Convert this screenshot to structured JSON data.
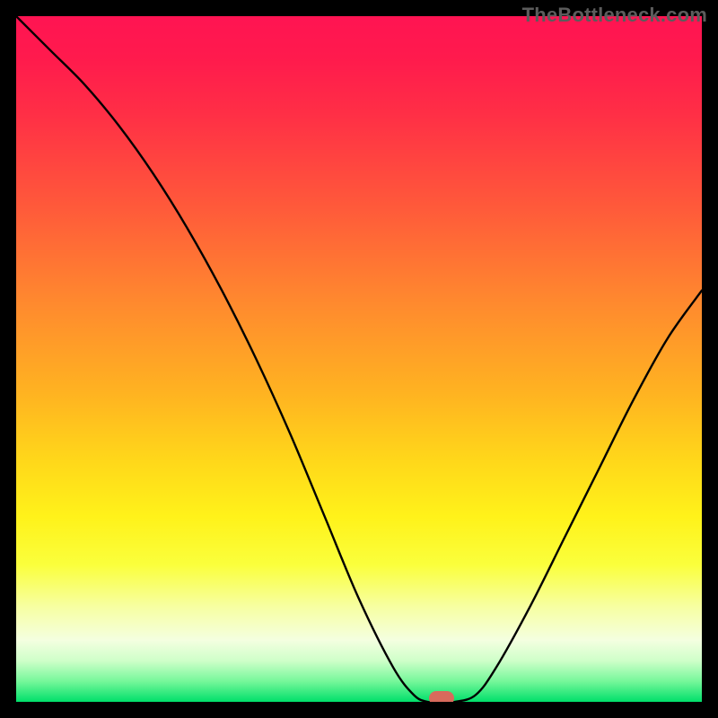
{
  "watermark": "TheBottleneck.com",
  "colors": {
    "frame": "#000000",
    "curve": "#000000",
    "marker": "#d86a5c",
    "watermark_text": "#5c5c5c"
  },
  "chart_data": {
    "type": "line",
    "title": "",
    "xlabel": "",
    "ylabel": "",
    "xlim": [
      0,
      100
    ],
    "ylim": [
      0,
      100
    ],
    "grid": false,
    "legend": false,
    "series": [
      {
        "name": "bottleneck-curve",
        "x": [
          0,
          5,
          10,
          15,
          20,
          25,
          30,
          35,
          40,
          45,
          50,
          55,
          58,
          60,
          62,
          64,
          67,
          70,
          75,
          80,
          85,
          90,
          95,
          100
        ],
        "values": [
          100,
          95,
          90,
          84,
          77,
          69,
          60,
          50,
          39,
          27,
          15,
          5,
          1,
          0,
          0,
          0,
          1,
          5,
          14,
          24,
          34,
          44,
          53,
          60
        ]
      }
    ],
    "marker": {
      "x": 62,
      "y": 0
    },
    "background_gradient_stops": [
      {
        "pct": 0,
        "color": "#ff1452"
      },
      {
        "pct": 14,
        "color": "#ff2e46"
      },
      {
        "pct": 42,
        "color": "#ff8a2e"
      },
      {
        "pct": 65,
        "color": "#ffd81a"
      },
      {
        "pct": 86,
        "color": "#f7ffa0"
      },
      {
        "pct": 97,
        "color": "#76f79a"
      },
      {
        "pct": 100,
        "color": "#00e06a"
      }
    ]
  }
}
